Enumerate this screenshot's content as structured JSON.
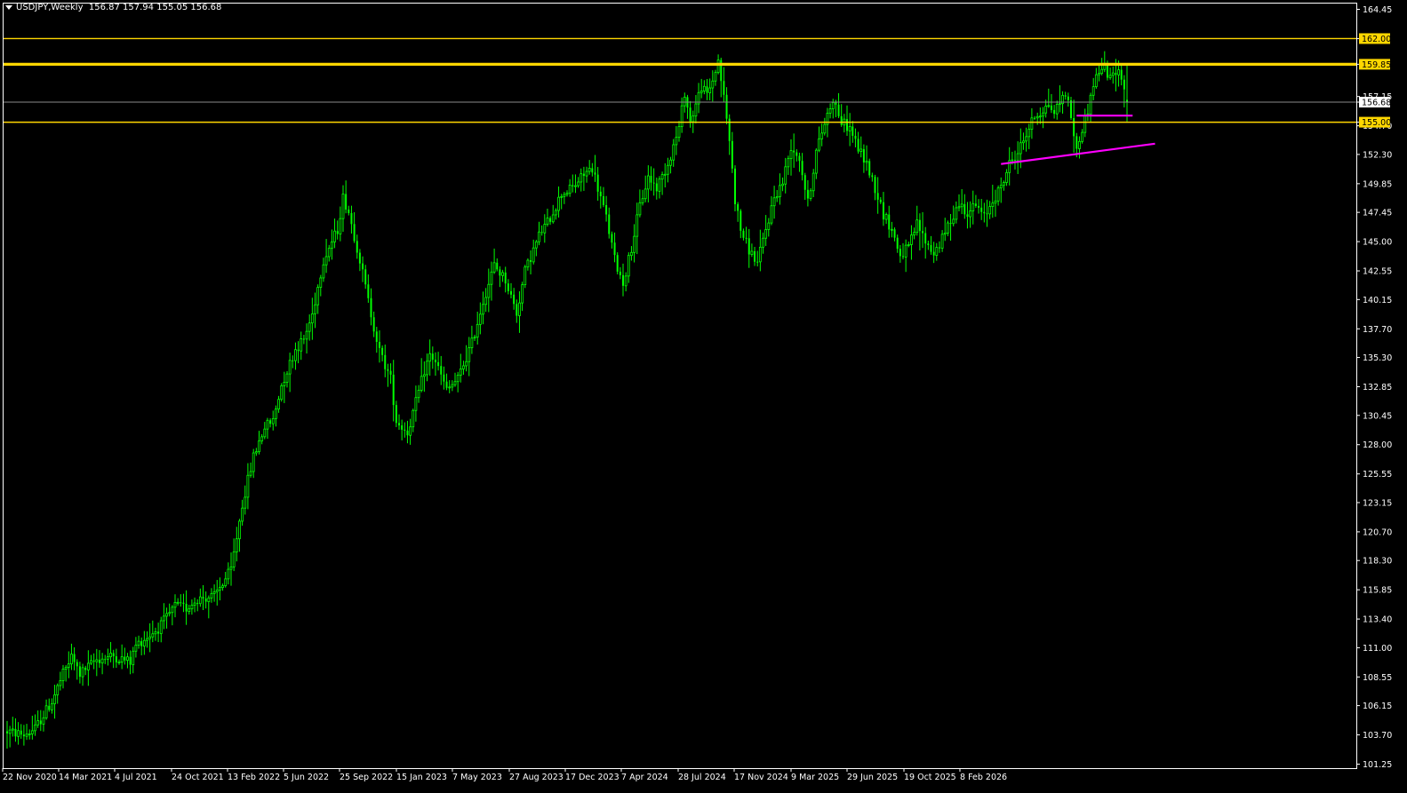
{
  "header": {
    "symbol": "USDJPY,Weekly",
    "ohlc": "156.87 157.94 155.05 156.68"
  },
  "colors": {
    "background": "#000000",
    "frame": "#ffffff",
    "candle": "#00ff00",
    "level": "#ffd700",
    "level_label_text": "#000000",
    "current_price_line": "#8a8a8a",
    "trendline": "#ff00ff",
    "axis_text": "#ffffff"
  },
  "chart_data": {
    "type": "candlestick",
    "timeframe": "Weekly",
    "ylim": [
      101.25,
      165.5
    ],
    "y_ticks": [
      "164.45",
      "162.00",
      "159.85",
      "157.15",
      "156.68",
      "155.00",
      "154.70",
      "152.30",
      "149.85",
      "147.45",
      "145.00",
      "142.55",
      "140.15",
      "137.70",
      "135.30",
      "132.85",
      "130.45",
      "128.00",
      "125.55",
      "123.15",
      "120.70",
      "118.30",
      "115.85",
      "113.40",
      "111.00",
      "108.55",
      "106.15",
      "103.70",
      "101.25"
    ],
    "x_ticks": [
      "22 Nov 2020",
      "14 Mar 2021",
      "4 Jul 2021",
      "24 Oct 2021",
      "13 Feb 2022",
      "5 Jun 2022",
      "25 Sep 2022",
      "15 Jan 2023",
      "7 May 2023",
      "27 Aug 2023",
      "17 Dec 2023",
      "7 Apr 2024",
      "28 Jul 2024",
      "17 Nov 2024",
      "9 Mar 2025",
      "29 Jun 2025",
      "19 Oct 2025",
      "8 Feb 2026"
    ],
    "price_path": [
      [
        0,
        104.0
      ],
      [
        6,
        103.7
      ],
      [
        10,
        104.2
      ],
      [
        16,
        106.5
      ],
      [
        20,
        108.8
      ],
      [
        23,
        110.2
      ],
      [
        26,
        108.8
      ],
      [
        32,
        110.0
      ],
      [
        38,
        110.3
      ],
      [
        44,
        109.8
      ],
      [
        46,
        111.2
      ],
      [
        54,
        112.6
      ],
      [
        57,
        113.5
      ],
      [
        60,
        114.5
      ],
      [
        64,
        114.3
      ],
      [
        68,
        115.1
      ],
      [
        74,
        115.3
      ],
      [
        80,
        117.5
      ],
      [
        84,
        123.0
      ],
      [
        88,
        127.0
      ],
      [
        92,
        129.5
      ],
      [
        95,
        130.0
      ],
      [
        98,
        133.0
      ],
      [
        103,
        136.0
      ],
      [
        106,
        136.8
      ],
      [
        109,
        138.9
      ],
      [
        113,
        143.5
      ],
      [
        118,
        146.0
      ],
      [
        120,
        148.7
      ],
      [
        122,
        147.5
      ],
      [
        126,
        143.5
      ],
      [
        129,
        140.0
      ],
      [
        133,
        135.8
      ],
      [
        137,
        133.5
      ],
      [
        139,
        130.0
      ],
      [
        143,
        129.0
      ],
      [
        146,
        131.5
      ],
      [
        149,
        134.2
      ],
      [
        151,
        135.5
      ],
      [
        153,
        135.0
      ],
      [
        157,
        132.5
      ],
      [
        161,
        133.5
      ],
      [
        166,
        136.5
      ],
      [
        170,
        140.0
      ],
      [
        174,
        143.0
      ],
      [
        178,
        141.8
      ],
      [
        182,
        139.0
      ],
      [
        185,
        142.5
      ],
      [
        190,
        145.5
      ],
      [
        194,
        147.0
      ],
      [
        198,
        149.0
      ],
      [
        202,
        149.5
      ],
      [
        206,
        150.6
      ],
      [
        209,
        151.2
      ],
      [
        211,
        149.5
      ],
      [
        214,
        147.0
      ],
      [
        217,
        143.5
      ],
      [
        220,
        141.5
      ],
      [
        223,
        144.5
      ],
      [
        226,
        148.0
      ],
      [
        229,
        150.4
      ],
      [
        232,
        149.5
      ],
      [
        236,
        151.5
      ],
      [
        238,
        153.0
      ],
      [
        240,
        154.5
      ],
      [
        242,
        157.5
      ],
      [
        244,
        155.0
      ],
      [
        246,
        156.5
      ],
      [
        248,
        158.0
      ],
      [
        250,
        157.2
      ],
      [
        252,
        158.5
      ],
      [
        254,
        160.2
      ],
      [
        256,
        157.0
      ],
      [
        258,
        153.5
      ],
      [
        260,
        148.5
      ],
      [
        262,
        146.0
      ],
      [
        265,
        144.3
      ],
      [
        268,
        143.2
      ],
      [
        271,
        146.0
      ],
      [
        274,
        148.7
      ],
      [
        277,
        150.0
      ],
      [
        280,
        153.0
      ],
      [
        283,
        152.0
      ],
      [
        286,
        148.2
      ],
      [
        289,
        152.5
      ],
      [
        292,
        155.0
      ],
      [
        295,
        157.0
      ],
      [
        298,
        155.0
      ],
      [
        301,
        154.5
      ],
      [
        304,
        152.8
      ],
      [
        307,
        151.5
      ],
      [
        310,
        149.5
      ],
      [
        313,
        147.3
      ],
      [
        316,
        146.0
      ],
      [
        319,
        143.8
      ],
      [
        322,
        144.5
      ],
      [
        325,
        146.5
      ],
      [
        328,
        145.0
      ],
      [
        331,
        144.0
      ],
      [
        334,
        145.2
      ],
      [
        337,
        146.8
      ],
      [
        340,
        148.2
      ],
      [
        343,
        147.5
      ],
      [
        346,
        148.0
      ],
      [
        349,
        147.0
      ],
      [
        352,
        148.5
      ],
      [
        355,
        149.5
      ],
      [
        358,
        151.5
      ],
      [
        361,
        152.5
      ],
      [
        364,
        154.0
      ],
      [
        367,
        155.5
      ],
      [
        370,
        156.0
      ],
      [
        372,
        156.5
      ],
      [
        374,
        155.8
      ],
      [
        376,
        156.7
      ],
      [
        378,
        157.5
      ],
      [
        380,
        155.5
      ],
      [
        382,
        152.5
      ],
      [
        384,
        154.5
      ],
      [
        386,
        156.0
      ],
      [
        388,
        158.2
      ],
      [
        390,
        159.3
      ],
      [
        392,
        159.6
      ],
      [
        394,
        158.5
      ],
      [
        396,
        159.4
      ],
      [
        398,
        158.9
      ],
      [
        400,
        156.7
      ]
    ],
    "levels": [
      {
        "price": 162.0,
        "label": "162.00",
        "thickness": 1.3
      },
      {
        "price": 159.85,
        "label": "159.85",
        "thickness": 3.2
      },
      {
        "price": 155.0,
        "label": "155.00",
        "thickness": 1.5
      }
    ],
    "current_price": {
      "price": 156.68,
      "label": "156.68"
    },
    "trendlines": [
      {
        "x1_week": 355,
        "y1": 151.5,
        "x2_week": 410,
        "y2": 153.2
      },
      {
        "x1_week": 382,
        "y1": 155.55,
        "x2_week": 402,
        "y2": 155.55
      }
    ],
    "grid": false
  }
}
